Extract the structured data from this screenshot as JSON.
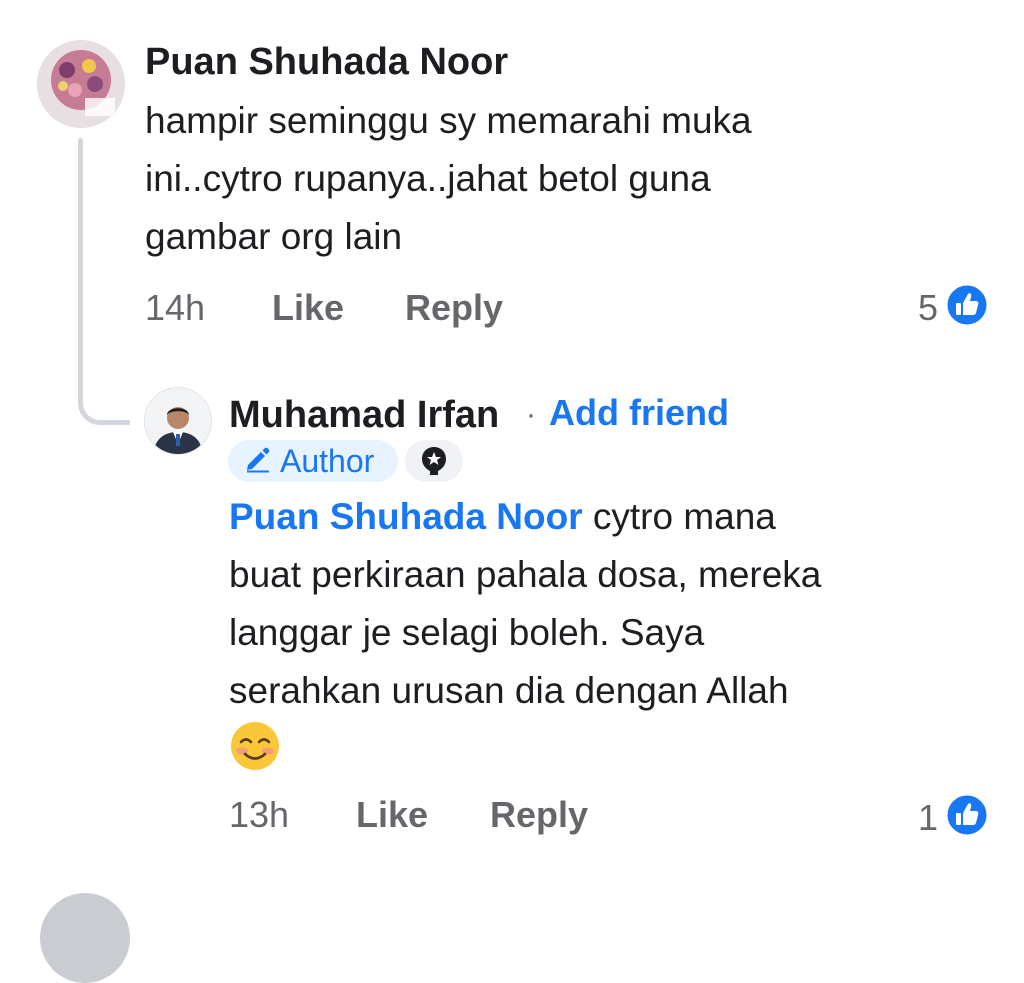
{
  "comment": {
    "author": "Puan Shuhada Noor",
    "lines": [
      "hampir seminggu sy memarahi muka",
      "ini..cytro rupanya..jahat betol guna",
      "gambar org lain"
    ],
    "time": "14h",
    "like_label": "Like",
    "reply_label": "Reply",
    "reaction_count": "5"
  },
  "reply": {
    "author": "Muhamad Irfan",
    "separator": "·",
    "add_friend_label": "Add friend",
    "badge_label": "Author",
    "mention": "Puan Shuhada Noor",
    "first_line_rest": " cytro mana",
    "lines": [
      "buat perkiraan pahala dosa, mereka",
      "langgar je selagi boleh. Saya",
      "serahkan urusan dia dengan Allah"
    ],
    "emoji": "smiling-face-emoji",
    "time": "13h",
    "like_label": "Like",
    "reply_label": "Reply",
    "reaction_count": "1"
  },
  "colors": {
    "link": "#1877f2",
    "meta": "#65676b",
    "thread_line": "#d3d6da",
    "badge_bg": "#e7f3ff"
  }
}
